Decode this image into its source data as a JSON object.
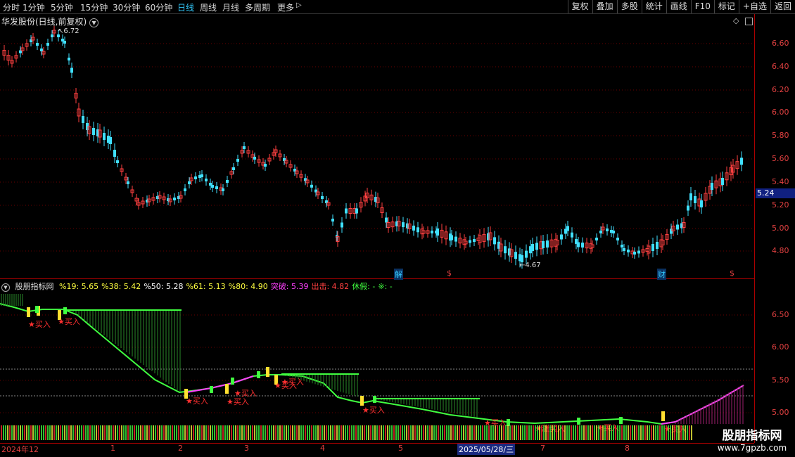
{
  "toolbar": {
    "periods": [
      "分时",
      "1分钟",
      "5分钟",
      "15分钟",
      "30分钟",
      "60分钟",
      "日线",
      "周线",
      "月线",
      "多周期",
      "更多"
    ],
    "active_period": "日线",
    "more_icon": "chevron-right-icon",
    "right_buttons": [
      "复权",
      "叠加",
      "多股",
      "统计",
      "画线",
      "F10",
      "标记",
      "+自选",
      "返回"
    ]
  },
  "main_panel": {
    "title": "华发股份(日线,前复权)",
    "dropdown_icon": "chevron-down-icon",
    "high_label": "6.72",
    "low_label": "4.67",
    "current_price": "5.24",
    "y_ticks": [
      "6.60",
      "6.40",
      "6.20",
      "6.00",
      "5.80",
      "5.60",
      "5.40",
      "5.20",
      "5.00",
      "4.80"
    ],
    "badges": [
      {
        "text": "解",
        "color": "#3cf"
      },
      {
        "text": "$",
        "color": "#e04040"
      },
      {
        "text": "财",
        "color": "#3cf"
      },
      {
        "text": "$",
        "color": "#e04040"
      }
    ]
  },
  "indicator_panel": {
    "name": "股朋指标网",
    "params": [
      {
        "label": "%19:",
        "value": "5.65",
        "color": "#ffff40"
      },
      {
        "label": "%38:",
        "value": "5.42",
        "color": "#ffff40"
      },
      {
        "label": "%50:",
        "value": "5.28",
        "color": "#ffffff"
      },
      {
        "label": "%61:",
        "value": "5.13",
        "color": "#ffff40"
      },
      {
        "label": "%80:",
        "value": "4.90",
        "color": "#ffff40"
      },
      {
        "label": "突破:",
        "value": "5.39",
        "color": "#ff40ff"
      },
      {
        "label": "出击:",
        "value": "4.82",
        "color": "#ff4040"
      },
      {
        "label": "休假:",
        "value": "-",
        "color": "#40ff40"
      },
      {
        "label": "※:",
        "value": "-",
        "color": "#40ff40"
      }
    ],
    "y_ticks": [
      "6.50",
      "6.00",
      "5.50",
      "5.00"
    ],
    "buy_label": "买入",
    "mixed_label": "涨买入"
  },
  "x_axis": {
    "labels": [
      "2024年12",
      "1",
      "2",
      "3",
      "4",
      "5",
      "2025/05/28/三",
      "7",
      "8"
    ],
    "selected": "2025/05/28/三"
  },
  "watermark": {
    "title": "股朋指标网",
    "url": "www.7gpzb.com"
  },
  "colors": {
    "up": "#ff4040",
    "down": "#40e0ff",
    "green_line": "#40ff40",
    "magenta_line": "#ff40ff",
    "axis": "#aa0000"
  }
}
